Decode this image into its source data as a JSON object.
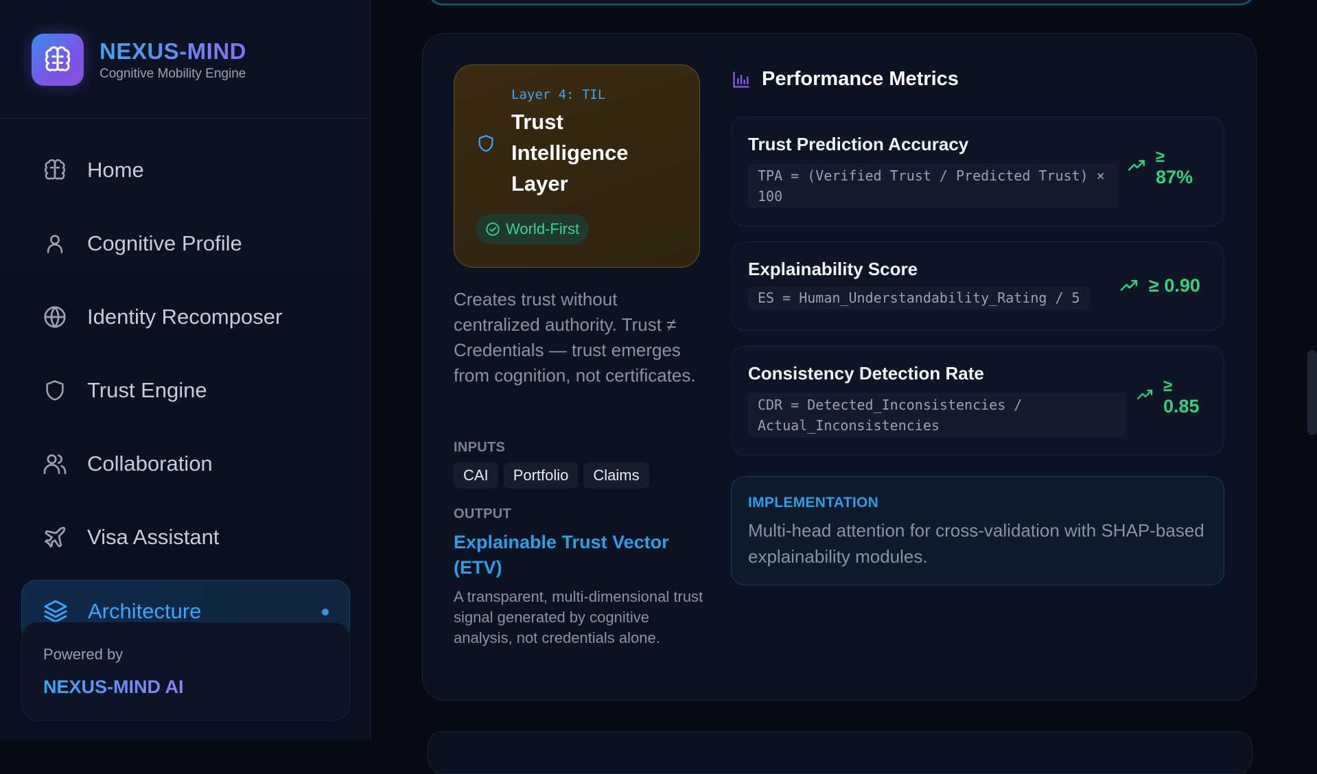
{
  "brand": {
    "title": "NEXUS-MIND",
    "subtitle": "Cognitive Mobility Engine",
    "logo_icon": "brain-icon"
  },
  "sidebar": {
    "items": [
      {
        "label": "Home",
        "icon": "brain-icon",
        "active": false
      },
      {
        "label": "Cognitive Profile",
        "icon": "user-icon",
        "active": false
      },
      {
        "label": "Identity Recomposer",
        "icon": "globe-icon",
        "active": false
      },
      {
        "label": "Trust Engine",
        "icon": "shield-icon",
        "active": false
      },
      {
        "label": "Collaboration",
        "icon": "users-icon",
        "active": false
      },
      {
        "label": "Visa Assistant",
        "icon": "plane-icon",
        "active": false
      },
      {
        "label": "Architecture",
        "icon": "layers-icon",
        "active": true
      }
    ],
    "powered_by": "Powered by",
    "powered_name": "NEXUS-MIND AI"
  },
  "layer": {
    "tag": "Layer 4: TIL",
    "title": "Trust Intelligence Layer",
    "badge": "World-First",
    "description": "Creates trust without centralized authority. Trust ≠ Credentials — trust emerges from cognition, not certificates.",
    "inputs_label": "INPUTS",
    "inputs": [
      "CAI",
      "Portfolio",
      "Claims"
    ],
    "output_label": "OUTPUT",
    "output_title": "Explainable Trust Vector (ETV)",
    "output_description": "A transparent, multi-dimensional trust signal generated by cognitive analysis, not credentials alone."
  },
  "metrics": {
    "title": "Performance Metrics",
    "items": [
      {
        "name": "Trust Prediction Accuracy",
        "formula": "TPA = (Verified Trust / Predicted Trust) × 100",
        "value_prefix": "≥",
        "value": "87%"
      },
      {
        "name": "Explainability Score",
        "formula": "ES = Human_Understandability_Rating / 5",
        "value": "≥ 0.90"
      },
      {
        "name": "Consistency Detection Rate",
        "formula": "CDR = Detected_Inconsistencies / Actual_Inconsistencies",
        "value_prefix": "≥",
        "value": "0.85"
      }
    ]
  },
  "implementation": {
    "label": "IMPLEMENTATION",
    "text": "Multi-head attention for cross-validation with SHAP-based explainability modules."
  },
  "colors": {
    "accent": "#2f9ee8",
    "success": "#34d37a",
    "badge": "#36d399",
    "layer_bg": "#3a2a10"
  }
}
